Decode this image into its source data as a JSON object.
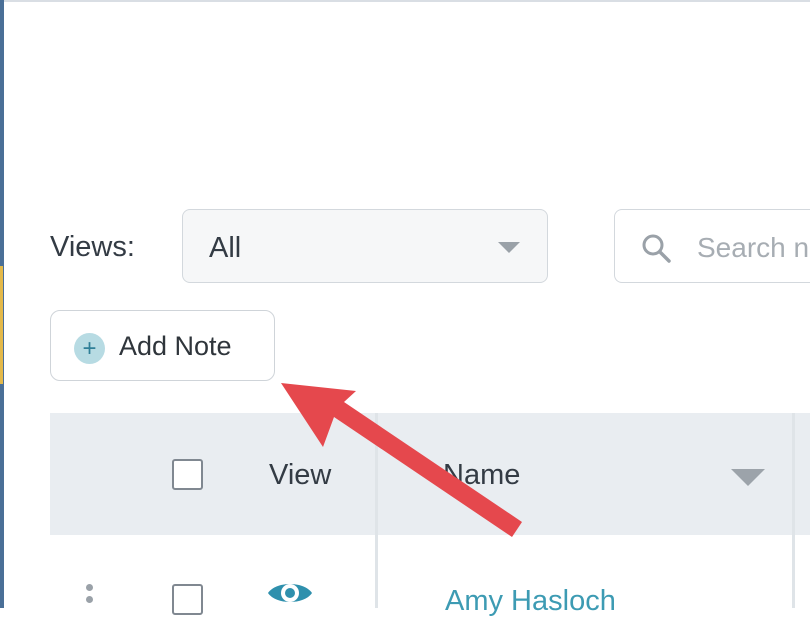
{
  "filters": {
    "views_label": "Views:",
    "views_selected": "All",
    "search_placeholder": "Search n"
  },
  "actions": {
    "add_note_label": "Add Note"
  },
  "table": {
    "columns": {
      "view": "View",
      "name": "Name"
    },
    "rows": [
      {
        "name": "Amy Hasloch"
      }
    ]
  },
  "colors": {
    "left_edge": "#4a6f97",
    "header_bg": "#e9edf1",
    "link": "#3d9bb3",
    "annotation_arrow": "#e5484d"
  },
  "icons": {
    "search": "search-icon",
    "add": "plus-circle-icon",
    "view": "eye-icon",
    "menu": "vertical-dots-icon"
  }
}
